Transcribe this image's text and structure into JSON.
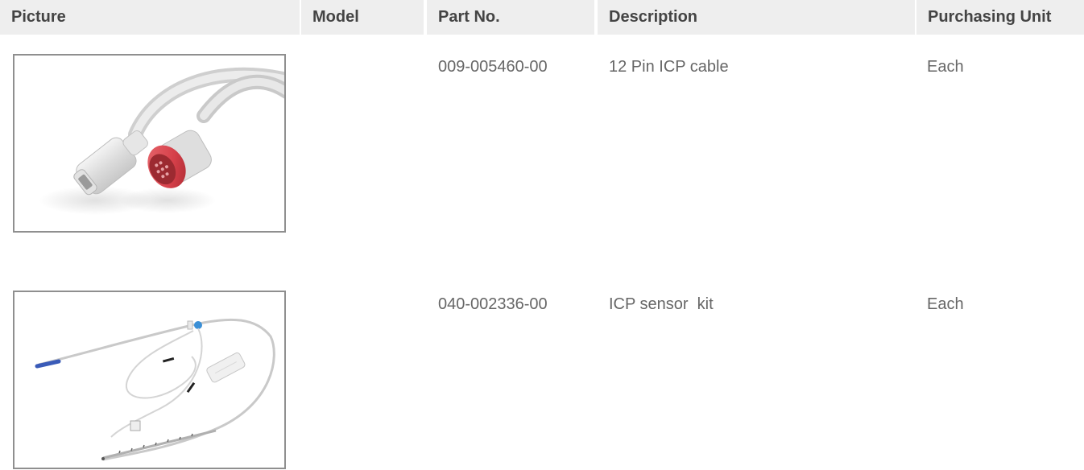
{
  "table": {
    "headers": {
      "picture": "Picture",
      "model": "Model",
      "part_no": "Part No.",
      "description": "Description",
      "purchasing_unit": "Purchasing Unit"
    },
    "rows": [
      {
        "picture_icon": "icp-cable-image",
        "model": "",
        "part_no": "009-005460-00",
        "description": "12 Pin ICP cable",
        "purchasing_unit": "Each"
      },
      {
        "picture_icon": "icp-sensor-kit-image",
        "model": "",
        "part_no": "040-002336-00",
        "description": "ICP sensor  kit",
        "purchasing_unit": "Each"
      }
    ]
  },
  "colors": {
    "header_bg": "#eeeeee",
    "header_text": "#444444",
    "cell_text": "#666666",
    "frame_border": "#8f8f8f",
    "connector_red": "#d6404a",
    "sensor_blue": "#3a5bb8"
  }
}
